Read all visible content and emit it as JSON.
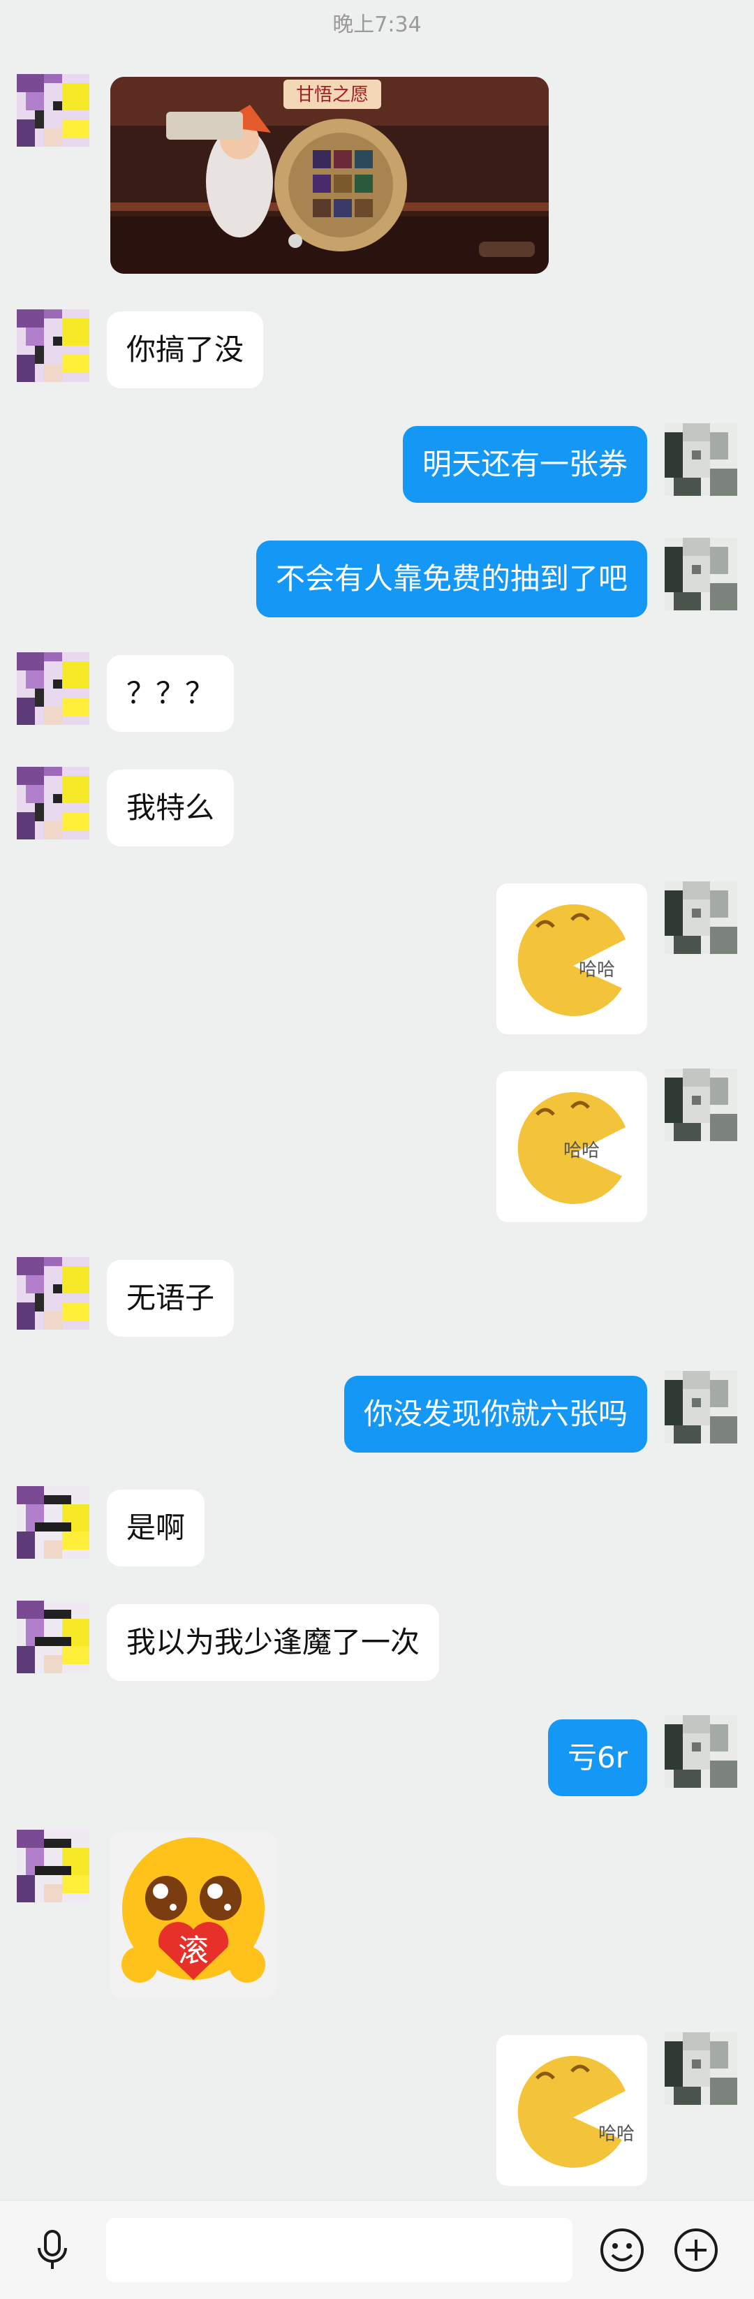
{
  "status": {
    "time": "晚上7:34"
  },
  "messages": [
    {
      "side": "left",
      "type": "image",
      "caption": "甘悟之愿"
    },
    {
      "side": "left",
      "type": "text",
      "text": "你搞了没"
    },
    {
      "side": "right",
      "type": "text",
      "text": "明天还有一张券"
    },
    {
      "side": "right",
      "type": "text",
      "text": "不会有人靠免费的抽到了吧"
    },
    {
      "side": "left",
      "type": "text",
      "text": "？？？"
    },
    {
      "side": "left",
      "type": "text",
      "text": "我特么"
    },
    {
      "side": "right",
      "type": "sticker",
      "sticker_text": "哈哈"
    },
    {
      "side": "right",
      "type": "sticker",
      "sticker_text": "哈哈"
    },
    {
      "side": "left",
      "type": "text",
      "text": "无语子"
    },
    {
      "side": "right",
      "type": "text",
      "text": "你没发现你就六张吗"
    },
    {
      "side": "left",
      "type": "text",
      "text": "是啊"
    },
    {
      "side": "left",
      "type": "text",
      "text": "我以为我少逢魔了一次"
    },
    {
      "side": "right",
      "type": "text",
      "text": "亏6r"
    },
    {
      "side": "left",
      "type": "sticker",
      "sticker_text": "滚"
    },
    {
      "side": "right",
      "type": "sticker",
      "sticker_text": "哈哈"
    }
  ],
  "input_bar": {
    "placeholder": ""
  },
  "icons": {
    "voice": "microphone-icon",
    "emoji": "emoji-icon",
    "more": "plus-icon"
  },
  "colors": {
    "outgoing_bubble": "#1598f5",
    "incoming_bubble": "#ffffff",
    "background": "#eef0ef"
  }
}
